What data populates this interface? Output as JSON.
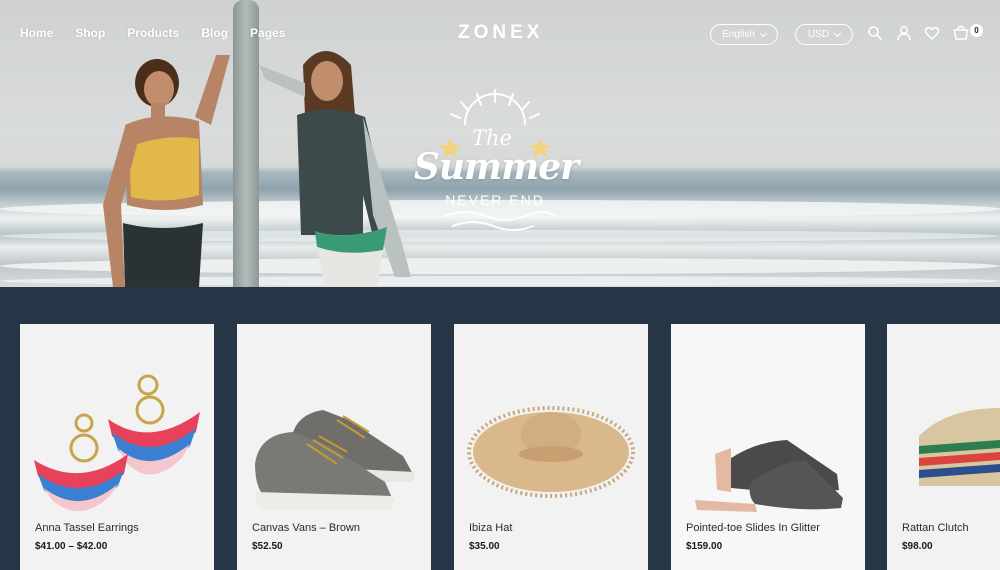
{
  "nav": {
    "links": [
      "Home",
      "Shop",
      "Products",
      "Blog",
      "Pages"
    ],
    "logo": "ZONEX",
    "language": "English",
    "currency": "USD",
    "cart_count": "0",
    "icons": [
      "search-icon",
      "user-icon",
      "heart-icon",
      "cart-icon"
    ]
  },
  "hero": {
    "headline_the": "The",
    "headline_summer": "Summer",
    "headline_sub": "NEVER END"
  },
  "products": [
    {
      "name": "Anna Tassel Earrings",
      "price": "$41.00 – $42.00"
    },
    {
      "name": "Canvas Vans – Brown",
      "price": "$52.50"
    },
    {
      "name": "Ibiza Hat",
      "price": "$35.00"
    },
    {
      "name": "Pointed-toe Slides In Glitter",
      "price": "$159.00"
    },
    {
      "name": "Rattan Clutch",
      "price": "$98.00"
    }
  ],
  "colors": {
    "product_bg": "#263646",
    "card_bg": "#f2f2f2",
    "text": "#ffffff"
  }
}
